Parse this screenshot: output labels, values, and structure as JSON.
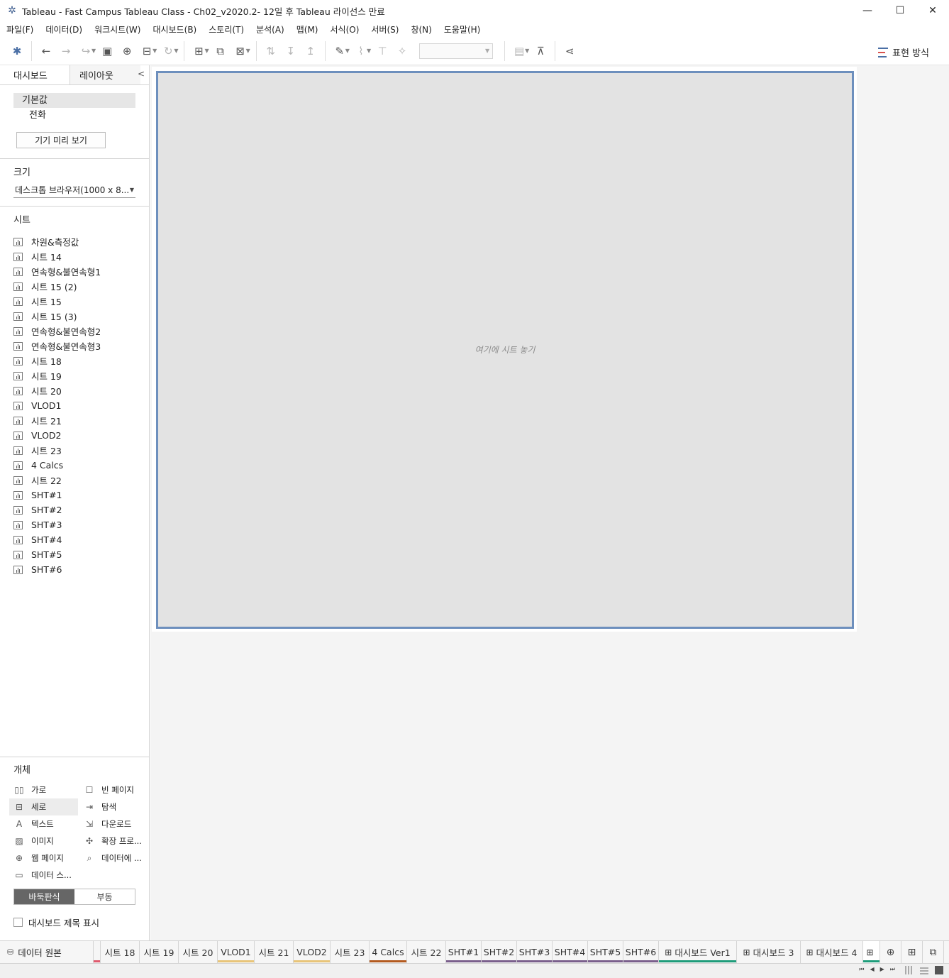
{
  "window": {
    "title": "Tableau - Fast Campus Tableau Class - Ch02_v2020.2- 12일 후 Tableau 라이선스 만료",
    "minimize": "—",
    "maximize": "☐",
    "close": "✕"
  },
  "menu": [
    "파일(F)",
    "데이터(D)",
    "워크시트(W)",
    "대시보드(B)",
    "스토리(T)",
    "분석(A)",
    "맵(M)",
    "서식(O)",
    "서버(S)",
    "창(N)",
    "도움말(H)"
  ],
  "toolbar": {
    "show_me": "표현 방식"
  },
  "left_pane": {
    "tabs": {
      "dashboard": "대시보드",
      "layout": "레이아웃"
    },
    "devices": {
      "default": "기본값",
      "phone": "전화"
    },
    "device_preview_button": "기기 미리 보기",
    "size_label": "크기",
    "size_value": "데스크톱 브라우저(1000 x 8...",
    "sheets_label": "시트",
    "sheets": [
      "차원&측정값",
      "시트 14",
      "연속형&불연속형1",
      "시트 15 (2)",
      "시트 15",
      "시트 15 (3)",
      "연속형&불연속형2",
      "연속형&불연속형3",
      "시트 18",
      "시트 19",
      "시트 20",
      "VLOD1",
      "시트 21",
      "VLOD2",
      "시트 23",
      "4 Calcs",
      "시트 22",
      "SHT#1",
      "SHT#2",
      "SHT#3",
      "SHT#4",
      "SHT#5",
      "SHT#6"
    ],
    "objects_label": "개체",
    "objects": [
      {
        "label": "가로",
        "icon": "horizontal-container-icon"
      },
      {
        "label": "빈 페이지",
        "icon": "blank-icon"
      },
      {
        "label": "세로",
        "icon": "vertical-container-icon"
      },
      {
        "label": "탐색",
        "icon": "navigation-icon"
      },
      {
        "label": "텍스트",
        "icon": "text-icon"
      },
      {
        "label": "다운로드",
        "icon": "download-icon"
      },
      {
        "label": "이미지",
        "icon": "image-icon"
      },
      {
        "label": "확장 프로...",
        "icon": "extension-icon"
      },
      {
        "label": "웹 페이지",
        "icon": "web-page-icon"
      },
      {
        "label": "데이터에 ...",
        "icon": "ask-data-icon"
      },
      {
        "label": "데이터 스...",
        "icon": "data-story-icon"
      }
    ],
    "tiled": "바둑판식",
    "floating": "부동",
    "show_title": "대시보드 제목 표시"
  },
  "canvas": {
    "drop_hint": "여기에 시트 놓기"
  },
  "bottom_tabs": {
    "data_source": "데이터 원본",
    "tabs": [
      {
        "label": "시트 18",
        "color": ""
      },
      {
        "label": "시트 19",
        "color": ""
      },
      {
        "label": "시트 20",
        "color": ""
      },
      {
        "label": "VLOD1",
        "color": "#e8c478"
      },
      {
        "label": "시트 21",
        "color": ""
      },
      {
        "label": "VLOD2",
        "color": "#e8c478"
      },
      {
        "label": "시트 23",
        "color": ""
      },
      {
        "label": "4 Calcs",
        "color": "#b35a1f"
      },
      {
        "label": "시트 22",
        "color": ""
      },
      {
        "label": "SHT#1",
        "color": "#7a5f8c"
      },
      {
        "label": "SHT#2",
        "color": "#7a5f8c"
      },
      {
        "label": "SHT#3",
        "color": "#7a5f8c"
      },
      {
        "label": "SHT#4",
        "color": "#7a5f8c"
      },
      {
        "label": "SHT#5",
        "color": "#7a5f8c"
      },
      {
        "label": "SHT#6",
        "color": "#7a5f8c"
      }
    ],
    "dashboards": [
      {
        "label": "대시보드 Ver1",
        "color": "#1e9c7a"
      },
      {
        "label": "대시보드 3",
        "color": ""
      },
      {
        "label": "대시보드 4",
        "color": ""
      }
    ]
  }
}
